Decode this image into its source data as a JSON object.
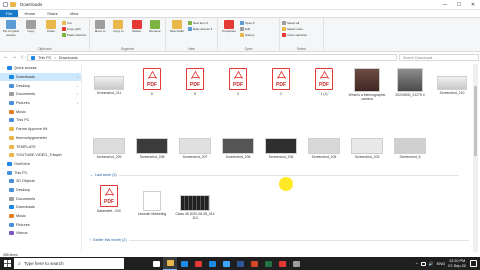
{
  "window": {
    "title": "Downloads",
    "controls": [
      "—",
      "☐",
      "✕"
    ]
  },
  "tabs": [
    "File",
    "Home",
    "Share",
    "View"
  ],
  "ribbon": {
    "groups": [
      {
        "label": "Clipboard",
        "big": [
          "Pin to Quick access",
          "Copy",
          "Paste"
        ],
        "small": [
          "Cut",
          "Copy path",
          "Paste shortcut"
        ]
      },
      {
        "label": "Organize",
        "big": [
          "Move to",
          "Copy to",
          "Delete",
          "Rename"
        ],
        "small": []
      },
      {
        "label": "New",
        "big": [
          "New folder"
        ],
        "small": [
          "New item ▾",
          "Easy access ▾"
        ]
      },
      {
        "label": "Open",
        "big": [
          "Properties"
        ],
        "small": [
          "Open ▾",
          "Edit",
          "History"
        ]
      },
      {
        "label": "Select",
        "big": [],
        "small": [
          "Select all",
          "Select none",
          "Invert selection"
        ]
      }
    ]
  },
  "address": {
    "back": "←",
    "forward": "→",
    "up": "↑",
    "path": [
      "This PC",
      "Downloads"
    ],
    "search_placeholder": "Search Downloads"
  },
  "nav": {
    "items": [
      {
        "label": "Quick access",
        "color": "#1e88e5",
        "level": 0,
        "chev": "⌄"
      },
      {
        "label": "Downloads",
        "color": "#1e88e5",
        "level": 1,
        "sel": true,
        "pin": "📌"
      },
      {
        "label": "Desktop",
        "color": "#4a90d9",
        "level": 1,
        "pin": "📌"
      },
      {
        "label": "Documents",
        "color": "#9e9e9e",
        "level": 1,
        "pin": "📌"
      },
      {
        "label": "Pictures",
        "color": "#4a90d9",
        "level": 1,
        "pin": "📌"
      },
      {
        "label": "Music",
        "color": "#e67e22",
        "level": 1
      },
      {
        "label": "This PC",
        "color": "#4a90d9",
        "level": 1
      },
      {
        "label": "Farme Approve Kit",
        "color": "#e8b84a",
        "level": 1
      },
      {
        "label": "thermohygrometer",
        "color": "#e8b84a",
        "level": 1
      },
      {
        "label": "TEMPLATE",
        "color": "#e8b84a",
        "level": 1
      },
      {
        "label": "YOUTUBE VIDEO_Trilayer",
        "color": "#e8b84a",
        "level": 1
      },
      {
        "label": "OneDrive",
        "color": "#1e88e5",
        "level": 0,
        "chev": "›"
      },
      {
        "label": "This PC",
        "color": "#4a90d9",
        "level": 0,
        "chev": "⌄"
      },
      {
        "label": "3D Objects",
        "color": "#4a90d9",
        "level": 1
      },
      {
        "label": "Desktop",
        "color": "#4a90d9",
        "level": 1
      },
      {
        "label": "Documents",
        "color": "#9e9e9e",
        "level": 1
      },
      {
        "label": "Downloads",
        "color": "#1e88e5",
        "level": 1
      },
      {
        "label": "Music",
        "color": "#e67e22",
        "level": 1
      },
      {
        "label": "Pictures",
        "color": "#4a90d9",
        "level": 1
      },
      {
        "label": "Videos",
        "color": "#7e57c2",
        "level": 1
      }
    ]
  },
  "files": {
    "row1": [
      {
        "name": "Screenshot_211",
        "kind": "thumb"
      },
      {
        "name": "6",
        "kind": "pdf"
      },
      {
        "name": "5",
        "kind": "pdf"
      },
      {
        "name": "4",
        "kind": "pdf"
      },
      {
        "name": "2",
        "kind": "pdf"
      },
      {
        "name": "1 (1)",
        "kind": "pdf"
      },
      {
        "name": "What is a thermographic camera",
        "kind": "photo"
      },
      {
        "name": "20200830_21275 4",
        "kind": "photo"
      },
      {
        "name": "Screenshot_210",
        "kind": "thumb"
      }
    ],
    "row2": [
      {
        "name": "Screenshot_209"
      },
      {
        "name": "Screenshot_208"
      },
      {
        "name": "Screenshot_207"
      },
      {
        "name": "Screenshot_206"
      },
      {
        "name": "Screenshot_205"
      },
      {
        "name": "Screenshot_204"
      },
      {
        "name": "Screenshot_203"
      },
      {
        "name": "Screenshot_6"
      }
    ],
    "section_last_week": "Last week (3)",
    "row3": [
      {
        "name": "Datasheet - INC",
        "kind": "pdf"
      },
      {
        "name": "Linkedin Marketing",
        "kind": "doc"
      },
      {
        "name": "Class 48 2020-08-05_014 113",
        "kind": "video"
      }
    ],
    "section_earlier": "Earlier this month (2)",
    "pdf_label": "PDF"
  },
  "status": {
    "count": "358 items"
  },
  "taskbar": {
    "search_placeholder": "Type here to search",
    "time": "12:20 PM",
    "date": "07-Sep-20",
    "lang": "ENG",
    "apps": [
      {
        "name": "task-view",
        "color": "#ffffff"
      },
      {
        "name": "file-explorer",
        "color": "#e8b84a",
        "active": true
      },
      {
        "name": "edge",
        "color": "#1e88e5"
      },
      {
        "name": "chrome",
        "color": "#e53935"
      },
      {
        "name": "store",
        "color": "#1e88e5"
      },
      {
        "name": "photos",
        "color": "#3ea6ff"
      },
      {
        "name": "word",
        "color": "#2b579a"
      },
      {
        "name": "powerpoint",
        "color": "#d24726"
      },
      {
        "name": "excel",
        "color": "#217346"
      },
      {
        "name": "acrobat",
        "color": "#e53935"
      },
      {
        "name": "settings",
        "color": "#9e9e9e"
      }
    ]
  },
  "colors": {
    "accent": "#1979ca",
    "pdf_red": "#e53935",
    "selection": "#cce8ff",
    "cursor_highlight": "#ffe600"
  }
}
